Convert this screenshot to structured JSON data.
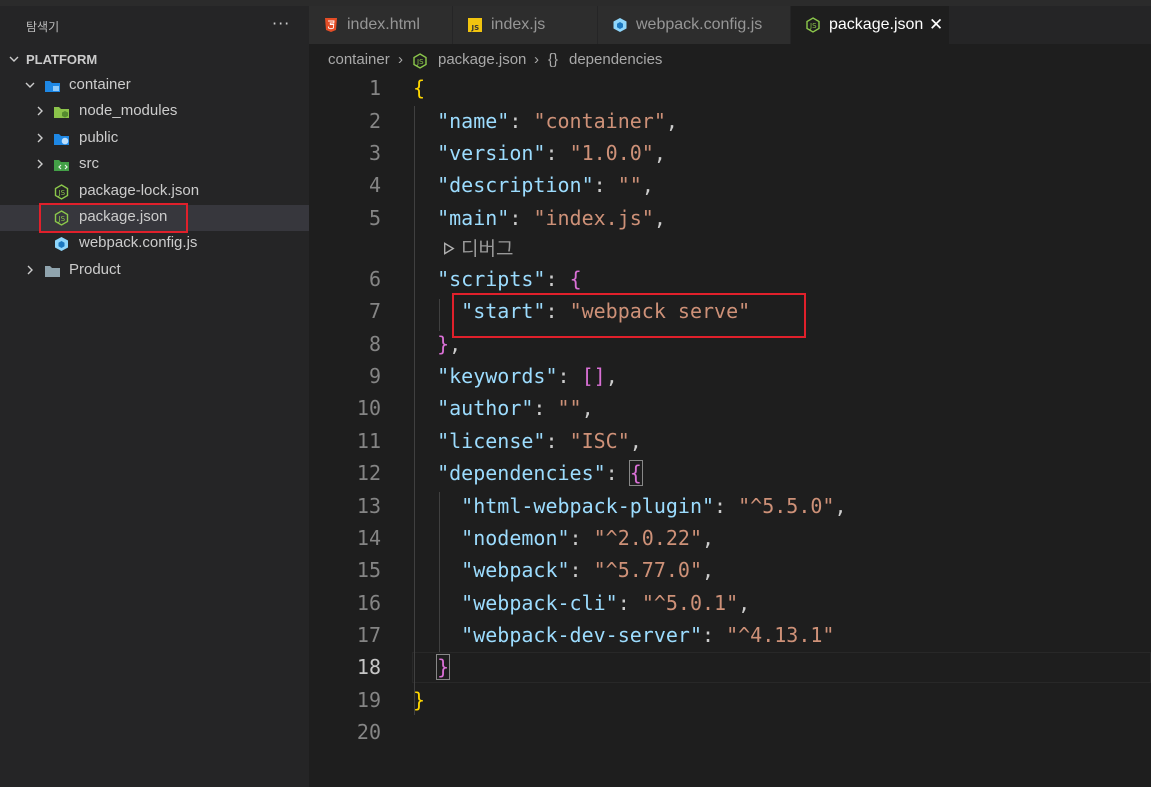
{
  "explorer": {
    "title": "탐색기",
    "more_icon": "ellipsis-icon",
    "root": "PLATFORM",
    "items": [
      {
        "label": "container",
        "icon": "folder-open-blue-icon",
        "chevron": "down"
      },
      {
        "label": "node_modules",
        "icon": "folder-node-icon",
        "chevron": "right"
      },
      {
        "label": "public",
        "icon": "folder-public-icon",
        "chevron": "right"
      },
      {
        "label": "src",
        "icon": "folder-src-icon",
        "chevron": "right"
      },
      {
        "label": "package-lock.json",
        "icon": "nodejs-file-icon"
      },
      {
        "label": "package.json",
        "icon": "nodejs-file-icon",
        "selected": true
      },
      {
        "label": "webpack.config.js",
        "icon": "webpack-file-icon"
      },
      {
        "label": "Product",
        "icon": "folder-icon",
        "chevron": "right"
      }
    ]
  },
  "tabs": [
    {
      "label": "index.html",
      "icon": "html5-icon"
    },
    {
      "label": "index.js",
      "icon": "javascript-icon"
    },
    {
      "label": "webpack.config.js",
      "icon": "webpack-icon"
    },
    {
      "label": "package.json",
      "icon": "nodejs-icon",
      "active": true,
      "close": "✕"
    }
  ],
  "breadcrumb": {
    "folder": "container",
    "sep": "›",
    "file": "package.json",
    "symbol_icon": "{}",
    "symbol": "dependencies"
  },
  "editor": {
    "line_numbers": [
      "1",
      "2",
      "3",
      "4",
      "5",
      "6",
      "7",
      "8",
      "9",
      "10",
      "11",
      "12",
      "13",
      "14",
      "15",
      "16",
      "17",
      "18",
      "19",
      "20"
    ],
    "current_line": "18",
    "codelens": "디버그",
    "code": {
      "l1_open": "{",
      "l2_key": "\"name\"",
      "l2_val": "\"container\"",
      "l3_key": "\"version\"",
      "l3_val": "\"1.0.0\"",
      "l4_key": "\"description\"",
      "l4_val": "\"\"",
      "l5_key": "\"main\"",
      "l5_val": "\"index.js\"",
      "l6_key": "\"scripts\"",
      "l6_open": "{",
      "l7_key": "\"start\"",
      "l7_val": "\"webpack serve\"",
      "l8_close": "}",
      "l9_key": "\"keywords\"",
      "l9_val": "[]",
      "l10_key": "\"author\"",
      "l10_val": "\"\"",
      "l11_key": "\"license\"",
      "l11_val": "\"ISC\"",
      "l12_key": "\"dependencies\"",
      "l12_open": "{",
      "l13_key": "\"html-webpack-plugin\"",
      "l13_val": "\"^5.5.0\"",
      "l14_key": "\"nodemon\"",
      "l14_val": "\"^2.0.22\"",
      "l15_key": "\"webpack\"",
      "l15_val": "\"^5.77.0\"",
      "l16_key": "\"webpack-cli\"",
      "l16_val": "\"^5.0.1\"",
      "l17_key": "\"webpack-dev-server\"",
      "l17_val": "\"^4.13.1\"",
      "l18_close": "}",
      "l19_close": "}",
      "colon": ": ",
      "comma": ","
    }
  },
  "colors": {
    "highlight_box": "#e0202b",
    "json_key": "#9cdcfe",
    "json_string": "#ce9178",
    "bracket_gold": "#ffd700",
    "bracket_pink": "#da70d6",
    "bracket_blue": "#179fff"
  }
}
